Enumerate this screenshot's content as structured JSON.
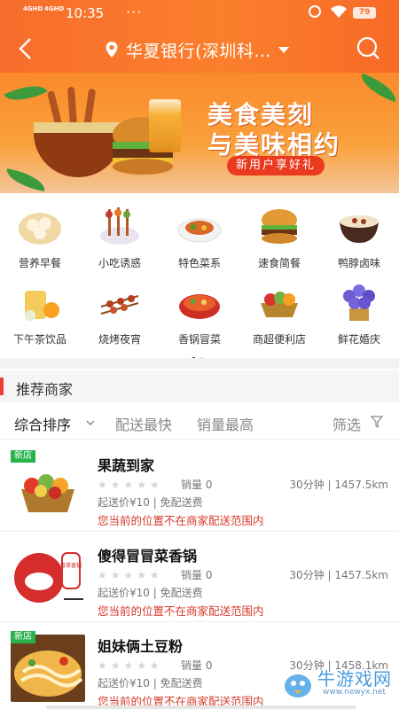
{
  "status_bar": {
    "signal_1": "4GHD",
    "signal_2": "4GHD",
    "time": "10:35",
    "more": "···",
    "battery": "79"
  },
  "header": {
    "location": "华夏银行(深圳科…",
    "icons": [
      "back-arrow-icon",
      "location-pin-icon",
      "caret-down-icon",
      "search-icon"
    ],
    "accent_color": "#f97a2c"
  },
  "banner": {
    "line1": "美食美刻",
    "line2": "与美味相约",
    "badge": "新用户享好礼"
  },
  "categories": [
    {
      "label": "营养早餐",
      "icon": "breakfast-icon"
    },
    {
      "label": "小吃诱惑",
      "icon": "snack-icon"
    },
    {
      "label": "特色菜系",
      "icon": "dish-icon"
    },
    {
      "label": "速食简餐",
      "icon": "burger-icon"
    },
    {
      "label": "鸭脖卤味",
      "icon": "braised-icon"
    },
    {
      "label": "下午茶饮品",
      "icon": "tea-icon"
    },
    {
      "label": "烧烤夜宵",
      "icon": "bbq-icon"
    },
    {
      "label": "香锅冒菜",
      "icon": "hotpot-icon"
    },
    {
      "label": "商超便利店",
      "icon": "grocery-icon"
    },
    {
      "label": "鲜花婚庆",
      "icon": "flowers-icon"
    }
  ],
  "recommend": {
    "title": "推荐商家",
    "accent_color": "#ef3b35"
  },
  "sort": {
    "options": [
      "综合排序",
      "配送最快",
      "销量最高"
    ],
    "filter": "筛选",
    "active_index": 0
  },
  "merchants": [
    {
      "name": "果蔬到家",
      "badge": "新店",
      "rating": 0,
      "sales": "销量 0",
      "distance": "30分钟 | 1457.5km",
      "fee": "起送价¥10 | 免配送费",
      "warning": "您当前的位置不在商家配送范围内"
    },
    {
      "name": "傻得冒冒菜香锅",
      "badge": "",
      "rating": 0,
      "sales": "销量 0",
      "distance": "30分钟 | 1457.5km",
      "fee": "起送价¥10 | 免配送费",
      "warning": "您当前的位置不在商家配送范围内"
    },
    {
      "name": "姐妹俩土豆粉",
      "badge": "新店",
      "rating": 0,
      "sales": "销量 0",
      "distance": "30分钟 | 1458.1km",
      "fee": "起送价¥10 | 免配送费",
      "warning": "您当前的位置不在商家配送范围内"
    }
  ],
  "watermark": {
    "title": "牛游戏网",
    "url": "www.newyx.net"
  },
  "thumbnail_2_text": "冒菜香锅"
}
